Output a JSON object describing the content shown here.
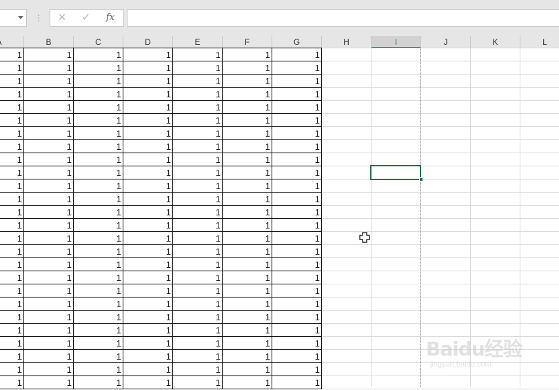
{
  "formula_bar": {
    "name_box": "",
    "cancel_glyph": "✕",
    "enter_glyph": "✓",
    "fx_label": "fx",
    "formula": ""
  },
  "columns": [
    "A",
    "B",
    "C",
    "D",
    "E",
    "F",
    "G",
    "H",
    "I",
    "J",
    "K",
    "L"
  ],
  "selected_column": "I",
  "filled_columns": [
    "A",
    "B",
    "C",
    "D",
    "E",
    "F",
    "G"
  ],
  "cell_value": "1",
  "visible_rows": 26,
  "colors": {
    "accent": "#217346",
    "header_bg": "#e6e6e6",
    "gridline": "#dadada"
  },
  "watermark": {
    "main": "Baidu经验",
    "url": "jingyan.baidu.com"
  }
}
